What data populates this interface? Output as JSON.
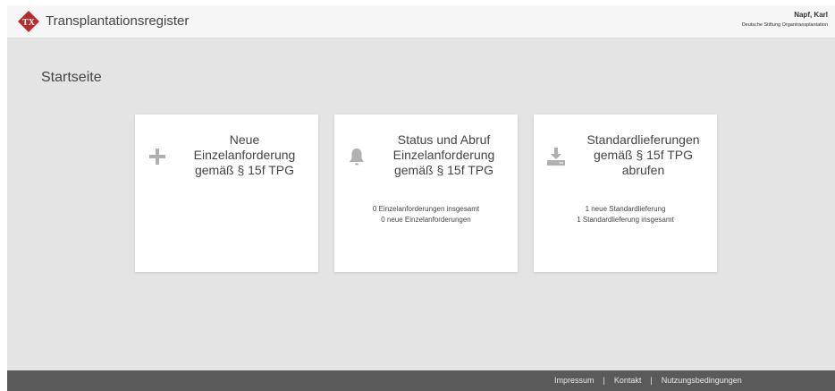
{
  "header": {
    "logo_text": "TX",
    "app_title": "Transplantationsregister",
    "user_name": "Napf, Karl",
    "user_org": "Deutsche Stiftung Organtransplantation"
  },
  "page": {
    "title": "Startseite"
  },
  "cards": [
    {
      "icon": "plus-icon",
      "title_lines": [
        "Neue",
        "Einzelanforderung",
        "gemäß § 15f TPG"
      ],
      "info_lines": []
    },
    {
      "icon": "bell-icon",
      "title_lines": [
        "Status und Abruf",
        "Einzelanforderung",
        "gemäß § 15f TPG"
      ],
      "info_lines": [
        "0 Einzelanforderungen insgesamt",
        "0 neue Einzelanforderungen"
      ]
    },
    {
      "icon": "download-icon",
      "title_lines": [
        "Standardlieferungen",
        "gemäß § 15f TPG",
        "abrufen"
      ],
      "info_lines": [
        "1 neue Standardlieferung",
        "1 Standardlieferung insgesamt"
      ]
    }
  ],
  "footer": {
    "impressum": "Impressum",
    "kontakt": "Kontakt",
    "nutzungsbedingungen": "Nutzungsbedingungen",
    "separator": "|"
  },
  "colors": {
    "brand_red": "#b52b2b",
    "background": "#e4e4e4",
    "footer": "#5a5a5a",
    "icon_gray": "#b0b0b0"
  }
}
